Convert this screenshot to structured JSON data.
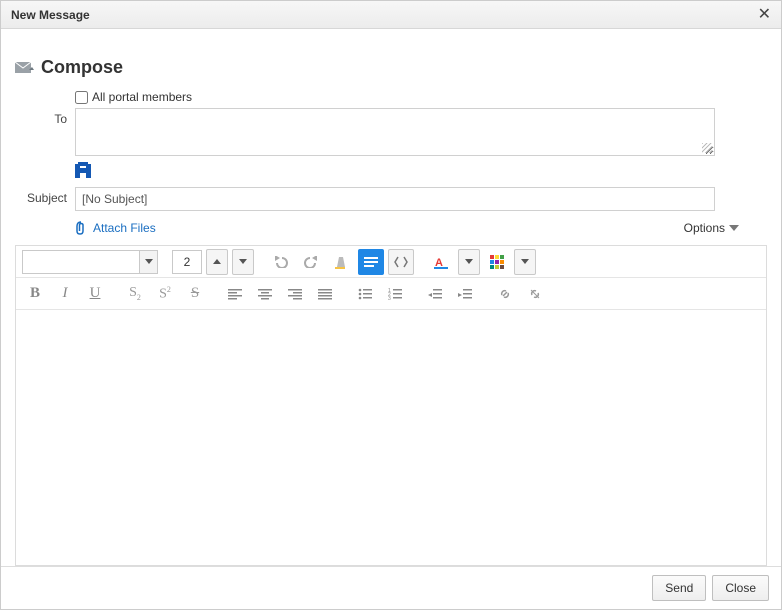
{
  "dialog": {
    "title": "New Message"
  },
  "heading": "Compose",
  "checkbox": {
    "all_portal_members": "All portal members"
  },
  "labels": {
    "to": "To",
    "subject": "Subject"
  },
  "subject": {
    "placeholder": "[No Subject]"
  },
  "attach": {
    "label": "Attach Files"
  },
  "options": {
    "label": "Options"
  },
  "editor": {
    "font_size": "2"
  },
  "footer": {
    "send": "Send",
    "close": "Close"
  },
  "icons": {
    "compose": "compose-mail",
    "unknown_recipient_badge": "H",
    "clip": "paperclip",
    "dropdown": "caret-down"
  }
}
